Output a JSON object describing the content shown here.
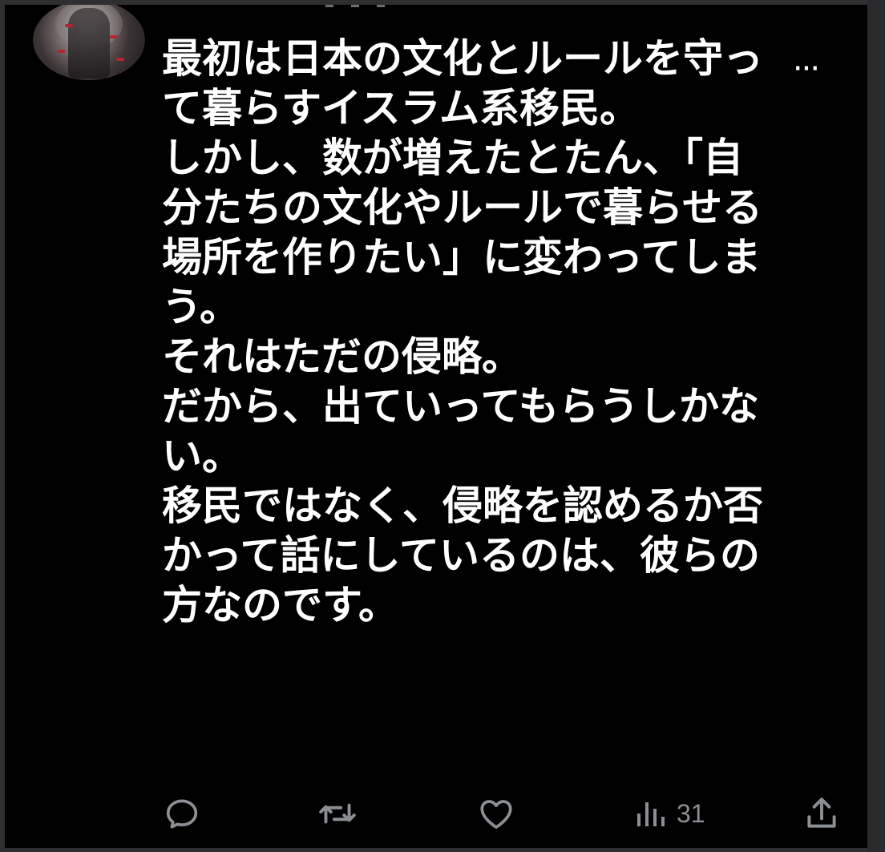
{
  "tweet": {
    "text_lines": [
      "最初は日本の文化とルールを守っ",
      "て暮らすイスラム系移民。",
      "しかし、数が増えたとたん、「自",
      "分たちの文化やルールで暮らせる",
      "場所を作りたい」に変わってしま",
      "う。",
      "それはただの侵略。",
      "だから、出ていってもらうしかな",
      "い。",
      "移民ではなく、侵略を認めるか否",
      "かって話にしているのは、彼らの",
      "方なのです。"
    ]
  },
  "header": {
    "more_label": "···"
  },
  "actions": {
    "reply_icon": "reply-icon",
    "retweet_icon": "retweet-icon",
    "like_icon": "heart-icon",
    "views_icon": "views-icon",
    "views_count": "31",
    "share_icon": "share-icon"
  },
  "colors": {
    "background": "#000000",
    "text": "#ffffff",
    "icon": "#8b8f94"
  }
}
